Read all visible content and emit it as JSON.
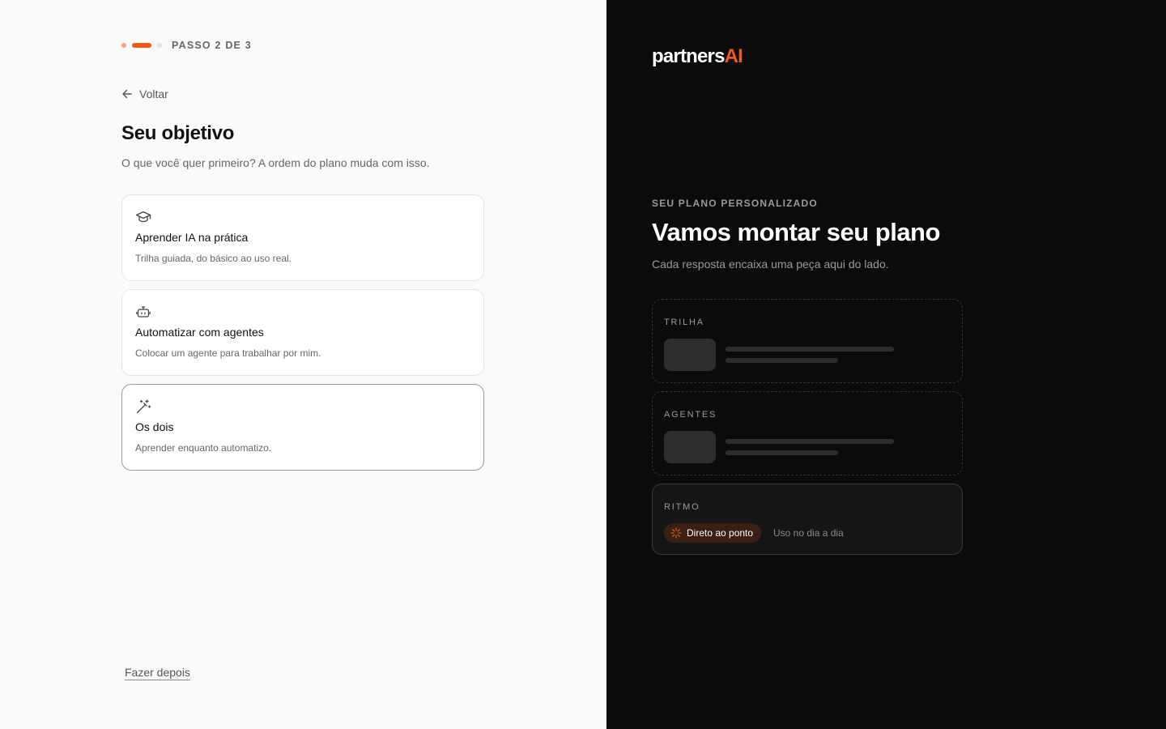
{
  "stepper": {
    "label": "PASSO 2 DE 3",
    "current": 2,
    "total": 3
  },
  "back": {
    "label": "Voltar",
    "icon": "arrow-left-icon"
  },
  "page": {
    "title": "Seu objetivo",
    "subtitle": "O que você quer primeiro? A ordem do plano muda com isso."
  },
  "options": [
    {
      "icon": "graduation-cap-icon",
      "title": "Aprender IA na prática",
      "description": "Trilha guiada, do básico ao uso real.",
      "selected": false
    },
    {
      "icon": "robot-icon",
      "title": "Automatizar com agentes",
      "description": "Colocar um agente para trabalhar por mim.",
      "selected": false
    },
    {
      "icon": "magic-wand-icon",
      "title": "Os dois",
      "description": "Aprender enquanto automatizo.",
      "selected": true
    }
  ],
  "later_link": "Fazer depois",
  "brand": {
    "name_part1": "partners",
    "name_part2": "AI",
    "accent": "#f15a16"
  },
  "plan": {
    "eyebrow": "SEU PLANO PERSONALIZADO",
    "title": "Vamos montar seu plano",
    "subtitle": "Cada resposta encaixa uma peça aqui do lado.",
    "cards": [
      {
        "label": "TRILHA",
        "state": "placeholder"
      },
      {
        "label": "AGENTES",
        "state": "placeholder"
      },
      {
        "label": "RITMO",
        "state": "filled",
        "chip": "Direto ao ponto",
        "chip_icon": "sparkle-icon",
        "alt_text": "Uso no dia a dia"
      }
    ]
  },
  "colors": {
    "left_bg": "#fafafa",
    "right_bg": "#0b0b0b",
    "accent": "#f15a16"
  }
}
